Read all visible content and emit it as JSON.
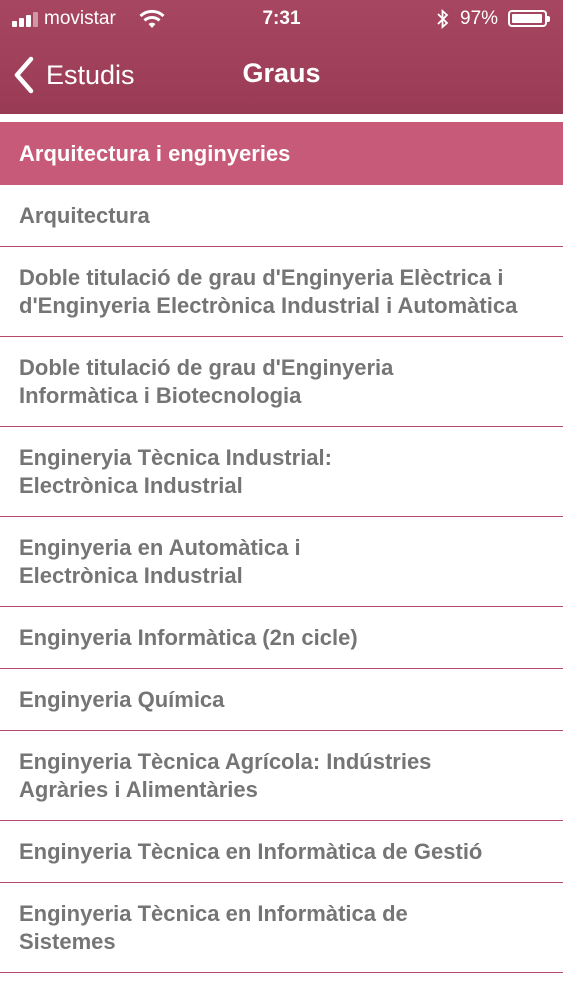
{
  "status_bar": {
    "carrier": "movistar",
    "time": "7:31",
    "battery_pct": "97%",
    "battery_level": 0.97
  },
  "nav": {
    "back_label": "Estudis",
    "title": "Graus"
  },
  "section": {
    "title": "Arquitectura i enginyeries"
  },
  "items": [
    {
      "label": "Arquitectura"
    },
    {
      "label": "Doble titulació de grau d'Enginyeria Elèctrica i d'Enginyeria Electrònica Industrial i Automàtica"
    },
    {
      "label": "Doble titulació de grau d'Enginyeria Informàtica i Biotecnologia"
    },
    {
      "label": "Engineryia Tècnica Industrial: Electrònica Industrial"
    },
    {
      "label": "Enginyeria en Automàtica i Electrònica Industrial"
    },
    {
      "label": "Enginyeria Informàtica (2n cicle)"
    },
    {
      "label": "Enginyeria Química"
    },
    {
      "label": "Enginyeria Tècnica Agrícola: Indústries Agràries i Alimentàries"
    },
    {
      "label": "Enginyeria Tècnica en Informàtica de Gestió"
    },
    {
      "label": "Enginyeria Tècnica en Informàtica de Sistemes"
    }
  ],
  "colors": {
    "nav_bar": "#9e3f59",
    "section_header": "#c85a79",
    "divider": "#b24a68",
    "item_text": "#757575"
  },
  "icons": {
    "back": "chevron-left-icon",
    "wifi": "wifi-icon",
    "bluetooth": "bluetooth-icon",
    "battery": "battery-icon",
    "signal": "signal-icon"
  }
}
